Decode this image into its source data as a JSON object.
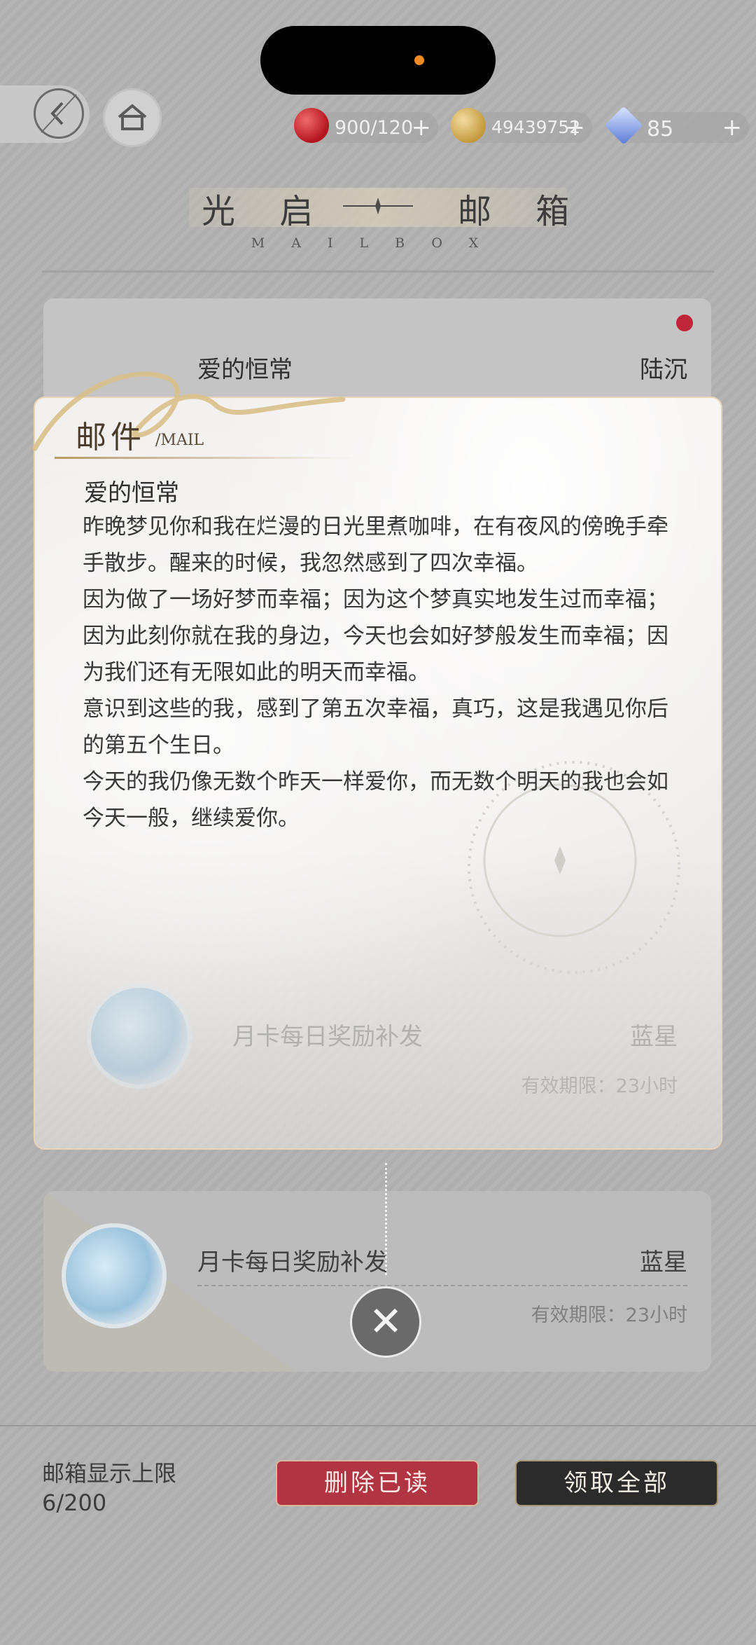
{
  "header": {
    "resources": [
      {
        "icon": "apple-stamina-icon",
        "value": "900/120"
      },
      {
        "icon": "gold-coin-icon",
        "value": "49439752"
      },
      {
        "icon": "blue-diamond-icon",
        "value": "85"
      }
    ],
    "title": "光启 ⟶ 邮箱",
    "title_left": "光 启",
    "title_right": "邮 箱",
    "subtitle": "MAILBOX"
  },
  "mail_list": [
    {
      "title": "爱的恒常",
      "sender": "陆沉",
      "unread": true
    },
    {
      "title": "月卡每日奖励补发",
      "sender": "蓝星",
      "expiry": "有效期限：23小时"
    },
    {
      "title": "月卡每日奖励补发",
      "sender": "蓝星",
      "expiry": "有效期限：23小时"
    }
  ],
  "mail_popup": {
    "label": "邮件",
    "label_sub": "/MAIL",
    "subject": "爱的恒常",
    "paragraphs": [
      "昨晚梦见你和我在烂漫的日光里煮咖啡，在有夜风的傍晚手牵手散步。醒来的时候，我忽然感到了四次幸福。",
      "因为做了一场好梦而幸福；因为这个梦真实地发生过而幸福；因为此刻你就在我的身边，今天也会如好梦般发生而幸福；因为我们还有无限如此的明天而幸福。",
      "意识到这些的我，感到了第五次幸福，真巧，这是我遇见你后的第五个生日。",
      "今天的我仍像无数个昨天一样爱你，而无数个明天的我也会如今天一般，继续爱你。"
    ]
  },
  "footer": {
    "limit_label": "邮箱显示上限",
    "limit_value": "6/200",
    "delete_read_label": "删除已读",
    "claim_all_label": "领取全部"
  },
  "colors": {
    "delete_button": "#b03441",
    "claim_button": "#2b2b2b",
    "unread_dot": "#c0263a"
  }
}
